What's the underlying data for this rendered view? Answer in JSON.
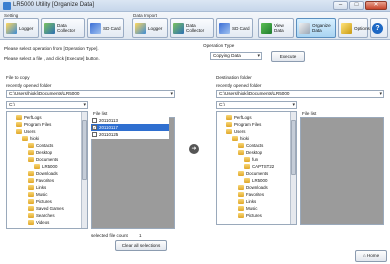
{
  "window": {
    "title": "LR5000 Utility [Organize Data]",
    "minimize_label": "–",
    "maximize_label": "□",
    "close_label": "✕"
  },
  "toolbar": {
    "setting_group": "Setting",
    "data_import_group": "Data Import",
    "buttons": [
      {
        "label": "Logger",
        "icon": "logger-icon"
      },
      {
        "label": "Data Collector",
        "icon": "collector-icon"
      },
      {
        "label": "SD Card",
        "icon": "sd-card-icon"
      },
      {
        "label": "Logger",
        "icon": "logger-icon"
      },
      {
        "label": "Data Collector",
        "icon": "collector-icon"
      },
      {
        "label": "SD Card",
        "icon": "sd-card-icon"
      },
      {
        "label": "View Data",
        "icon": "view-data-icon"
      },
      {
        "label": "Organize Data",
        "icon": "organize-data-icon"
      },
      {
        "label": "Options",
        "icon": "options-icon"
      },
      {
        "label": "Help",
        "icon": "help-icon"
      }
    ]
  },
  "instructions": {
    "line1": "Please select operation from [Operation Type].",
    "line2": "Please select a file , and click [Execute] button."
  },
  "operation": {
    "label": "Operation Type",
    "value": "Copying Data",
    "execute_label": "Execute"
  },
  "source": {
    "section_label": "File to copy",
    "recent_label": "recently opened folder",
    "recent_value": "C:\\Users\\hioki\\Documents\\LR5000",
    "drive_value": "C:\\",
    "tree": [
      "PerfLogs",
      "Program Files",
      "Users",
      "hioki",
      "Contacts",
      "Desktop",
      "Documents",
      "LR5000",
      "Downloads",
      "Favorites",
      "Links",
      "Music",
      "Pictures",
      "Saved Games",
      "Searches",
      "Videos"
    ],
    "filelist_label": "File list",
    "files": [
      {
        "name": "20110113",
        "checked": false
      },
      {
        "name": "20110117",
        "checked": true
      },
      {
        "name": "20110125",
        "checked": false
      }
    ],
    "selected_count_label": "selected file count",
    "selected_count_value": "1",
    "clear_label": "Clear all selections"
  },
  "destination": {
    "section_label": "Destination folder",
    "recent_label": "recently opened folder",
    "recent_value": "C:\\Users\\hioki\\Documents\\LR5000",
    "drive_value": "C:\\",
    "tree": [
      "PerfLogs",
      "Program Files",
      "Users",
      "hioki",
      "Contacts",
      "Desktop",
      "fun",
      "CAPTST22",
      "Documents",
      "LR5000",
      "Downloads",
      "Favorites",
      "Links",
      "Music",
      "Pictures"
    ],
    "filelist_label": "File list"
  },
  "home_label": "Home",
  "transfer_arrow": "➜"
}
